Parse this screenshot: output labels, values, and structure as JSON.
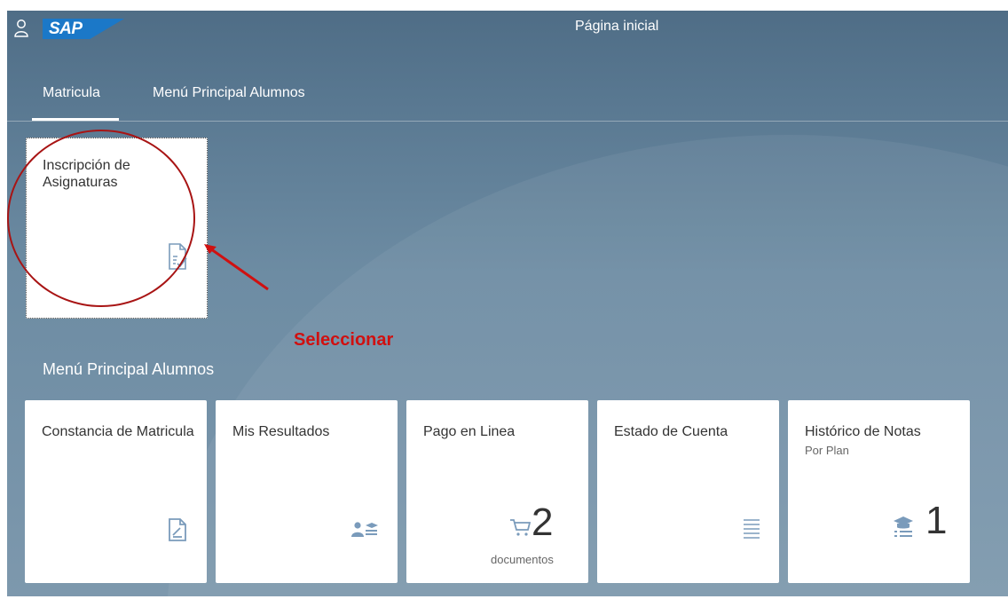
{
  "header": {
    "page_title": "Página inicial",
    "logo_text": "SAP",
    "user_icon": "user-icon"
  },
  "tabs": [
    {
      "label": "Matricula",
      "active": true
    },
    {
      "label": "Menú Principal Alumnos",
      "active": false
    }
  ],
  "group_matricula": {
    "tiles": [
      {
        "title": "Inscripción de Asignaturas",
        "icon": "document-edit-icon"
      }
    ]
  },
  "group_menu": {
    "title": "Menú Principal Alumnos",
    "tiles": [
      {
        "title": "Constancia de Matricula",
        "icon": "document-edit-icon"
      },
      {
        "title": "Mis Resultados",
        "icon": "student-icon"
      },
      {
        "title": "Pago en Linea",
        "icon": "cart-icon",
        "number": "2",
        "unit": "documentos"
      },
      {
        "title": "Estado de Cuenta",
        "icon": "list-icon"
      },
      {
        "title": "Histórico de Notas",
        "subtitle": "Por Plan",
        "icon": "education-icon",
        "number": "1"
      }
    ]
  },
  "annotation": {
    "label": "Seleccionar",
    "color": "#d01010"
  },
  "colors": {
    "background": "#5f7f98",
    "tile": "#ffffff",
    "icon": "#7a9bbb",
    "sap_blue": "#1b78c8"
  }
}
